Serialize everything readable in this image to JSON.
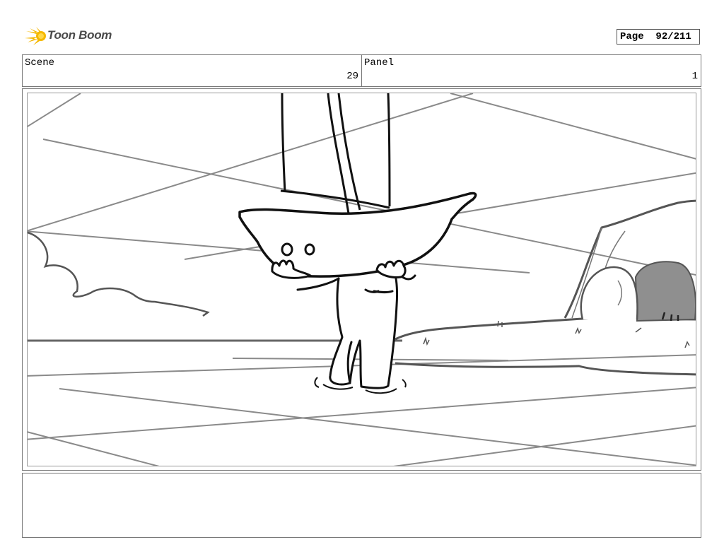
{
  "logo": {
    "brand": "Toon Boom"
  },
  "page": {
    "label": "Page",
    "value": "92/211"
  },
  "header": {
    "scene_label": "Scene",
    "scene_value": "29",
    "panel_label": "Panel",
    "panel_value": "1"
  },
  "colors": {
    "logo_accent": "#f5b800",
    "ink": "#111111",
    "guide_lines": "#8a8a8a",
    "cave": "#8f8f8f"
  }
}
